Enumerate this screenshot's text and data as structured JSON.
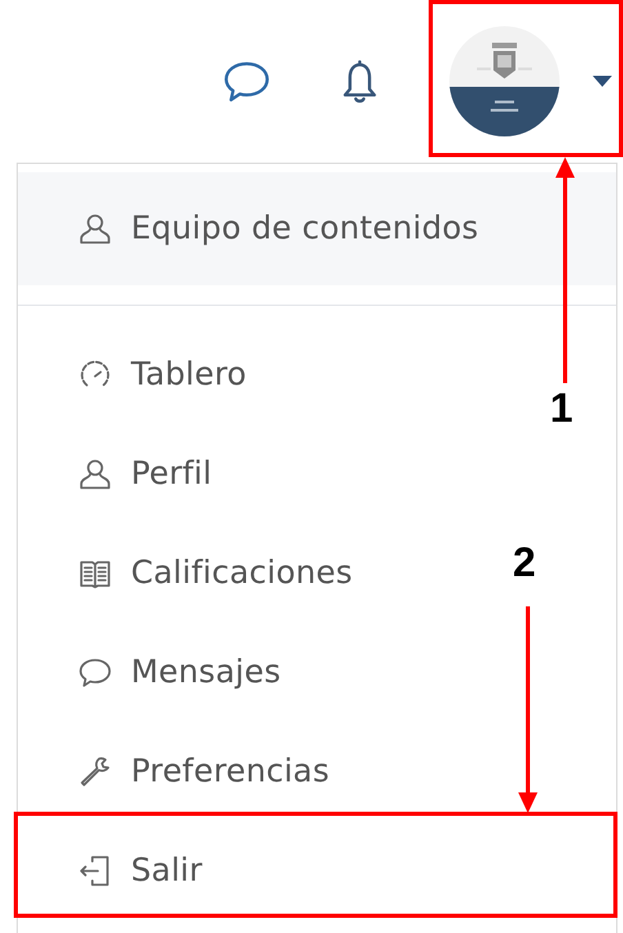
{
  "header": {
    "icons": [
      {
        "kind": "messages"
      },
      {
        "kind": "notifications"
      }
    ]
  },
  "menu": {
    "user": {
      "label": "Equipo de contenidos",
      "kind": "user"
    },
    "items": [
      {
        "label": "Tablero",
        "kind": "dashboard"
      },
      {
        "label": "Perfil",
        "kind": "user"
      },
      {
        "label": "Calificaciones",
        "kind": "grades"
      },
      {
        "label": "Mensajes",
        "kind": "messages"
      },
      {
        "label": "Preferencias",
        "kind": "preferences"
      },
      {
        "label": "Salir",
        "kind": "logout"
      }
    ]
  },
  "annotations": [
    {
      "label": "1",
      "kind": "up"
    },
    {
      "label": "2",
      "kind": "down"
    }
  ]
}
